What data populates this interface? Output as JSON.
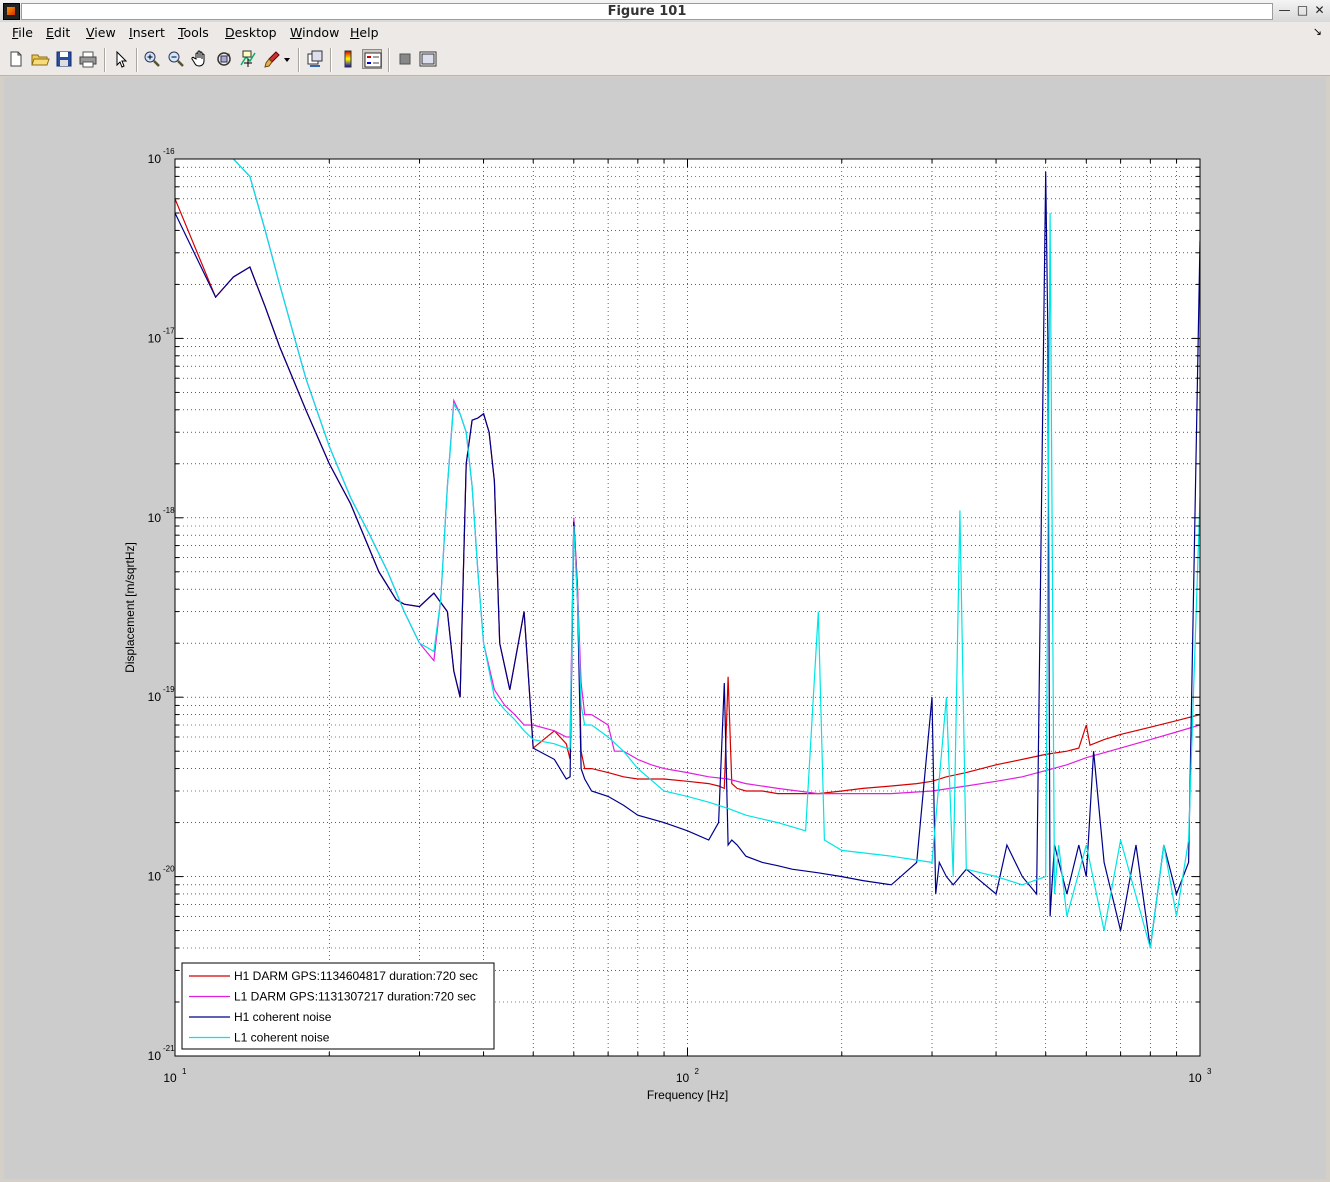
{
  "window": {
    "title": "Figure 101",
    "controls": [
      "—",
      "□",
      "✕"
    ]
  },
  "menu": [
    {
      "label": "File",
      "key": "F",
      "rest": "ile"
    },
    {
      "label": "Edit",
      "key": "E",
      "rest": "dit"
    },
    {
      "label": "View",
      "key": "V",
      "rest": "iew"
    },
    {
      "label": "Insert",
      "key": "I",
      "rest": "nsert"
    },
    {
      "label": "Tools",
      "key": "T",
      "rest": "ools"
    },
    {
      "label": "Desktop",
      "key": "D",
      "rest": "esktop"
    },
    {
      "label": "Window",
      "key": "W",
      "rest": "indow"
    },
    {
      "label": "Help",
      "key": "H",
      "rest": "elp"
    }
  ],
  "menu_dock_glyph": "↘",
  "toolbar": [
    "new-figure-icon",
    "open-file-icon",
    "save-icon",
    "print-icon",
    "pointer-icon",
    "zoom-in-icon",
    "zoom-out-icon",
    "pan-hand-icon",
    "rotate-3d-icon",
    "data-cursor-icon",
    "brush-icon",
    "brush-dropdown-icon",
    "link-plot-icon",
    "colorbar-icon",
    "legend-icon",
    "hide-plot-tools-icon",
    "show-plot-tools-icon"
  ],
  "chart_data": {
    "type": "line",
    "xscale": "log",
    "yscale": "log",
    "xlim": [
      10,
      1000
    ],
    "ylim": [
      1e-21,
      1e-16
    ],
    "xlabel": "Frequency [Hz]",
    "ylabel": "Displacement [m/sqrtHz]",
    "title": "",
    "grid": true,
    "legend_position": "bottom-left",
    "x_ticks": [
      {
        "base": "10",
        "exp": "1"
      },
      {
        "base": "10",
        "exp": "2"
      },
      {
        "base": "10",
        "exp": "3"
      }
    ],
    "y_ticks": [
      {
        "base": "10",
        "exp": "-21"
      },
      {
        "base": "10",
        "exp": "-20"
      },
      {
        "base": "10",
        "exp": "-19"
      },
      {
        "base": "10",
        "exp": "-18"
      },
      {
        "base": "10",
        "exp": "-17"
      },
      {
        "base": "10",
        "exp": "-16"
      }
    ],
    "series": [
      {
        "name": "H1 DARM GPS:1134604817 duration:720 sec",
        "color": "#d40000",
        "x": [
          10,
          12,
          13,
          14,
          15,
          16,
          18,
          20,
          22,
          25,
          27,
          28,
          30,
          32,
          34,
          35,
          36,
          37,
          38,
          39,
          40,
          41,
          42,
          43,
          45,
          48,
          50,
          55,
          58,
          59,
          60,
          61,
          62,
          63,
          65,
          70,
          75,
          80,
          90,
          100,
          110,
          115,
          118,
          120,
          122,
          125,
          130,
          140,
          150,
          160,
          180,
          200,
          220,
          250,
          280,
          300,
          320,
          350,
          400,
          450,
          500,
          550,
          580,
          600,
          610,
          650,
          700,
          800,
          900,
          1000
        ],
        "y": [
          6e-17,
          1.7e-17,
          2.2e-17,
          2.5e-17,
          1.5e-17,
          9e-18,
          4e-18,
          2e-18,
          1.2e-18,
          5e-19,
          3.5e-19,
          3.3e-19,
          3.2e-19,
          3.8e-19,
          3e-19,
          1.4e-19,
          1e-19,
          2e-18,
          3.5e-18,
          3.6e-18,
          3.8e-18,
          3e-18,
          1.6e-18,
          2e-19,
          1.1e-19,
          3e-19,
          5.2e-20,
          6.5e-20,
          5.5e-20,
          4.5e-20,
          9.5e-19,
          4.2e-19,
          5e-20,
          4e-20,
          4e-20,
          3.8e-20,
          3.6e-20,
          3.5e-20,
          3.5e-20,
          3.4e-20,
          3.3e-20,
          3.2e-20,
          3.1e-20,
          1.3e-19,
          3.3e-20,
          3.1e-20,
          3e-20,
          3e-20,
          2.9e-20,
          2.9e-20,
          2.9e-20,
          3e-20,
          3.1e-20,
          3.2e-20,
          3.3e-20,
          3.4e-20,
          3.6e-20,
          3.8e-20,
          4.2e-20,
          4.5e-20,
          4.8e-20,
          5e-20,
          5.2e-20,
          7e-20,
          5.4e-20,
          5.8e-20,
          6.2e-20,
          6.8e-20,
          7.4e-20,
          8e-20
        ]
      },
      {
        "name": "L1 DARM GPS:1131307217 duration:720 sec",
        "color": "#e020e0",
        "x": [
          13,
          14,
          15,
          16,
          18,
          20,
          22,
          24,
          26,
          28,
          30,
          32,
          33,
          34,
          35,
          36,
          37,
          38,
          39,
          40,
          42,
          44,
          46,
          48,
          50,
          55,
          58,
          59,
          60,
          61,
          62,
          63,
          65,
          70,
          72,
          75,
          80,
          85,
          90,
          100,
          110,
          120,
          130,
          150,
          180,
          200,
          250,
          300,
          350,
          400,
          450,
          500,
          550,
          600,
          700,
          800,
          900,
          1000
        ],
        "y": [
          1e-16,
          8e-17,
          4e-17,
          2e-17,
          6e-18,
          2.5e-18,
          1.3e-18,
          8e-19,
          5e-19,
          3e-19,
          2e-19,
          1.6e-19,
          3.5e-19,
          1.5e-18,
          4.5e-18,
          3.8e-18,
          3e-18,
          1.5e-18,
          5e-19,
          2e-19,
          1.1e-19,
          9e-20,
          8e-20,
          7e-20,
          7e-20,
          6.5e-20,
          6e-20,
          6e-20,
          1e-18,
          4e-19,
          1.2e-19,
          8e-20,
          8e-20,
          7e-20,
          5e-20,
          5e-20,
          4.5e-20,
          4.2e-20,
          4e-20,
          3.8e-20,
          3.6e-20,
          3.5e-20,
          3.3e-20,
          3.1e-20,
          2.9e-20,
          2.9e-20,
          2.9e-20,
          3e-20,
          3.2e-20,
          3.4e-20,
          3.6e-20,
          3.9e-20,
          4.2e-20,
          4.6e-20,
          5.2e-20,
          5.8e-20,
          6.4e-20,
          7e-20
        ]
      },
      {
        "name": "H1 coherent noise",
        "color": "#00008b",
        "x": [
          10,
          12,
          13,
          14,
          15,
          16,
          18,
          20,
          22,
          25,
          27,
          28,
          30,
          32,
          34,
          35,
          36,
          37,
          38,
          39,
          40,
          41,
          42,
          43,
          45,
          48,
          50,
          55,
          58,
          59,
          60,
          61,
          62,
          63,
          65,
          70,
          75,
          80,
          90,
          100,
          110,
          115,
          118,
          120,
          122,
          125,
          130,
          140,
          150,
          160,
          180,
          200,
          220,
          250,
          280,
          300,
          305,
          310,
          320,
          330,
          350,
          400,
          420,
          450,
          480,
          500,
          505,
          510,
          520,
          550,
          580,
          600,
          620,
          650,
          700,
          750,
          800,
          850,
          900,
          950,
          1000
        ],
        "y": [
          5e-17,
          1.7e-17,
          2.2e-17,
          2.5e-17,
          1.5e-17,
          9e-18,
          4e-18,
          2e-18,
          1.2e-18,
          5e-19,
          3.5e-19,
          3.3e-19,
          3.2e-19,
          3.8e-19,
          3e-19,
          1.4e-19,
          1e-19,
          2e-18,
          3.5e-18,
          3.6e-18,
          3.8e-18,
          3e-18,
          1.6e-18,
          2e-19,
          1.1e-19,
          3e-19,
          5.2e-20,
          4.5e-20,
          3.5e-20,
          3.6e-20,
          9.5e-19,
          3.5e-19,
          4e-20,
          3.5e-20,
          3e-20,
          2.8e-20,
          2.5e-20,
          2.2e-20,
          2e-20,
          1.8e-20,
          1.6e-20,
          2e-20,
          1.2e-19,
          1.5e-20,
          1.6e-20,
          1.5e-20,
          1.3e-20,
          1.2e-20,
          1.15e-20,
          1.1e-20,
          1.05e-20,
          1e-20,
          9.5e-21,
          9e-21,
          1.2e-20,
          1e-19,
          8e-21,
          1.2e-20,
          1e-20,
          9e-21,
          1.1e-20,
          8e-21,
          1.5e-20,
          1e-20,
          8e-21,
          8.5e-17,
          1e-17,
          6e-21,
          1.5e-20,
          8e-21,
          1.5e-20,
          1e-20,
          5e-20,
          1.2e-20,
          5e-21,
          1.5e-20,
          4e-21,
          1.5e-20,
          8e-21,
          1.2e-20,
          3.5e-17
        ]
      },
      {
        "name": "L1 coherent noise",
        "color": "#00e5e5",
        "x": [
          13,
          14,
          15,
          16,
          18,
          20,
          22,
          24,
          26,
          28,
          30,
          32,
          33,
          34,
          35,
          36,
          37,
          38,
          39,
          40,
          42,
          44,
          46,
          48,
          50,
          55,
          58,
          59,
          60,
          61,
          62,
          63,
          65,
          70,
          75,
          80,
          90,
          100,
          110,
          120,
          130,
          150,
          170,
          180,
          185,
          200,
          250,
          300,
          320,
          330,
          340,
          350,
          400,
          450,
          500,
          510,
          520,
          530,
          550,
          600,
          650,
          700,
          800,
          850,
          900,
          950,
          1000
        ],
        "y": [
          1e-16,
          8e-17,
          4e-17,
          2e-17,
          6e-18,
          2.5e-18,
          1.3e-18,
          8e-19,
          5e-19,
          3e-19,
          2e-19,
          1.8e-19,
          3.5e-19,
          1.5e-18,
          4.3e-18,
          3.8e-18,
          3e-18,
          1.5e-18,
          5e-19,
          2e-19,
          1e-19,
          8.5e-20,
          7.5e-20,
          6.5e-20,
          5.8e-20,
          5.5e-20,
          5.2e-20,
          5.2e-20,
          9e-19,
          3.5e-19,
          9e-20,
          7e-20,
          7e-20,
          6e-20,
          5e-20,
          4e-20,
          3e-20,
          2.8e-20,
          2.6e-20,
          2.4e-20,
          2.2e-20,
          2e-20,
          1.8e-20,
          3e-19,
          1.6e-20,
          1.4e-20,
          1.3e-20,
          1.2e-20,
          1e-19,
          1e-20,
          1.1e-18,
          1.1e-20,
          1e-20,
          9e-21,
          1e-20,
          5e-17,
          8e-21,
          1.5e-20,
          6e-21,
          1.5e-20,
          5e-21,
          1.6e-20,
          4e-21,
          1.5e-20,
          6e-21,
          1.6e-20,
          1.3e-18
        ]
      }
    ]
  }
}
